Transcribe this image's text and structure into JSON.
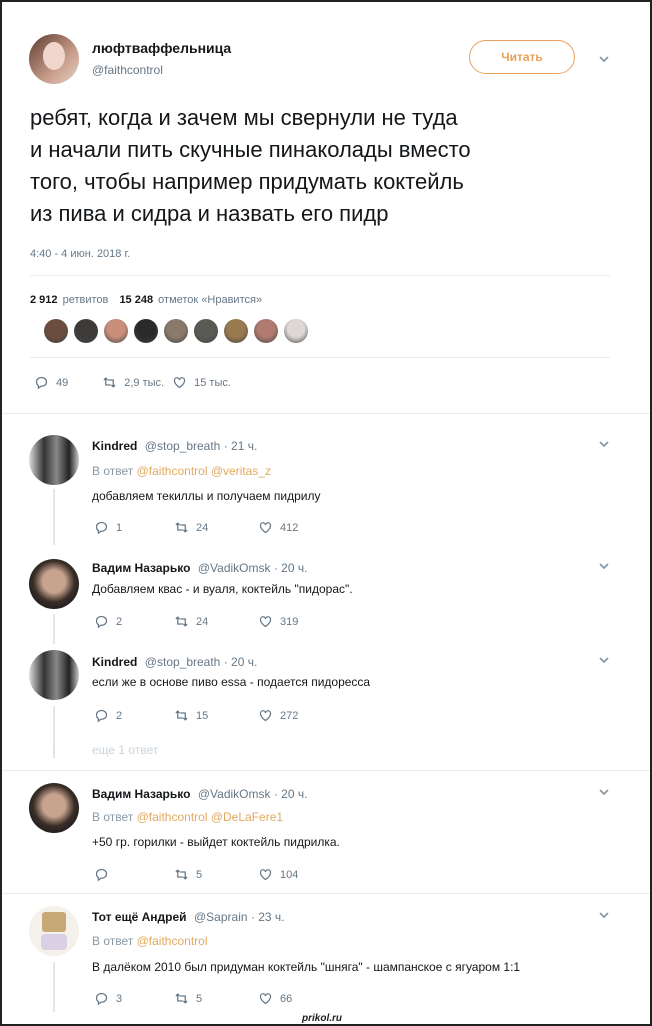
{
  "main_tweet": {
    "name": "люфтваффельница",
    "handle": "@faithcontrol",
    "follow_label": "Читать",
    "text_lines": [
      "ребят, когда и зачем мы свернули не туда",
      "и начали пить скучные пинаколады вместо",
      "того, чтобы например придумать коктейль",
      "из пива и сидра и назвать его пидр"
    ],
    "timestamp": "4:40 - 4 июн. 2018 г.",
    "retweets_count": "2 912",
    "retweets_label": "ретвитов",
    "likes_count": "15 248",
    "likes_label": "отметок «Нравится»",
    "replies": "49",
    "retweets_short": "2,9 тыс.",
    "likes_short": "15 тыс.",
    "liker_colors": [
      "#6b4e3d",
      "#3d3a3a",
      "#c98f7a",
      "#2a2a2a",
      "#8a7a6a",
      "#5a5a55",
      "#9a7a50",
      "#b07a70",
      "#ddd8d5"
    ]
  },
  "replies": [
    {
      "name": "Kindred",
      "handle": "@stop_breath · 21 ч.",
      "reply_prefix": "В ответ",
      "reply_to": "@faithcontrol @veritas_z",
      "text": "добавляем текиллы и получаем пидрилу",
      "replies": "1",
      "retweets": "24",
      "likes": "412"
    },
    {
      "name": "Вадим Назарько",
      "handle": "@VadikOmsk · 20 ч.",
      "text": "Добавляем квас - и вуаля, коктейль \"пидорас\".",
      "replies": "2",
      "retweets": "24",
      "likes": "319"
    },
    {
      "name": "Kindred",
      "handle": "@stop_breath · 20 ч.",
      "text": "если же в основе пиво essa - подается пидоресса",
      "replies": "2",
      "retweets": "15",
      "likes": "272"
    },
    {
      "name": "Вадим Назарько",
      "handle": "@VadikOmsk · 20 ч.",
      "reply_prefix": "В ответ",
      "reply_to": "@faithcontrol @DeLaFere1",
      "text": "+50 гр. горилки - выйдет коктейль пидрилка.",
      "replies": "",
      "retweets": "5",
      "likes": "104"
    },
    {
      "name": "Тот ещё Андрей",
      "handle": "@Saprain · 23 ч.",
      "reply_prefix": "В ответ",
      "reply_to": "@faithcontrol",
      "text": "В далёком 2010 был придуман коктейль \"шняга\" - шампанское с ягуаром 1:1",
      "replies": "3",
      "retweets": "5",
      "likes": "66"
    }
  ],
  "more_replies": "еще 1 ответ",
  "watermark": "prikol.ru",
  "colors": {
    "accent": "#e8a15b",
    "text": "#14171a",
    "muted": "#657786"
  }
}
